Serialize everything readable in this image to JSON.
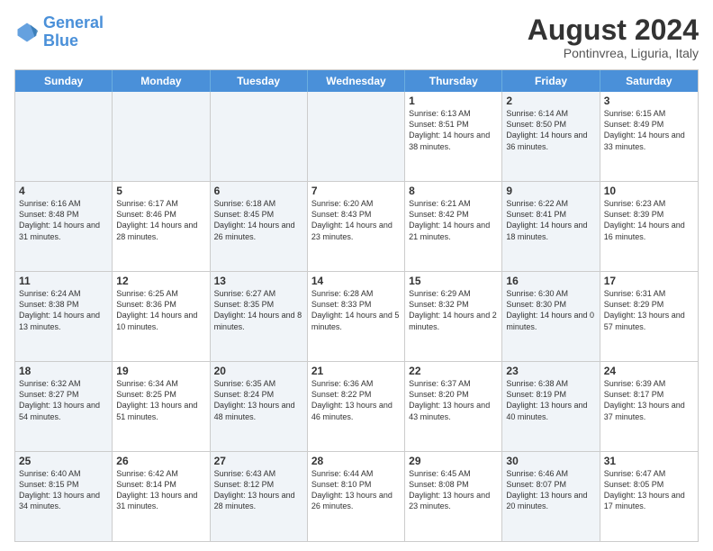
{
  "logo": {
    "line1": "General",
    "line2": "Blue"
  },
  "title": "August 2024",
  "location": "Pontinvrea, Liguria, Italy",
  "days_of_week": [
    "Sunday",
    "Monday",
    "Tuesday",
    "Wednesday",
    "Thursday",
    "Friday",
    "Saturday"
  ],
  "weeks": [
    [
      {
        "day": "",
        "text": "",
        "shaded": true
      },
      {
        "day": "",
        "text": "",
        "shaded": true
      },
      {
        "day": "",
        "text": "",
        "shaded": true
      },
      {
        "day": "",
        "text": "",
        "shaded": true
      },
      {
        "day": "1",
        "text": "Sunrise: 6:13 AM\nSunset: 8:51 PM\nDaylight: 14 hours\nand 38 minutes.",
        "shaded": false
      },
      {
        "day": "2",
        "text": "Sunrise: 6:14 AM\nSunset: 8:50 PM\nDaylight: 14 hours\nand 36 minutes.",
        "shaded": true
      },
      {
        "day": "3",
        "text": "Sunrise: 6:15 AM\nSunset: 8:49 PM\nDaylight: 14 hours\nand 33 minutes.",
        "shaded": false
      }
    ],
    [
      {
        "day": "4",
        "text": "Sunrise: 6:16 AM\nSunset: 8:48 PM\nDaylight: 14 hours\nand 31 minutes.",
        "shaded": true
      },
      {
        "day": "5",
        "text": "Sunrise: 6:17 AM\nSunset: 8:46 PM\nDaylight: 14 hours\nand 28 minutes.",
        "shaded": false
      },
      {
        "day": "6",
        "text": "Sunrise: 6:18 AM\nSunset: 8:45 PM\nDaylight: 14 hours\nand 26 minutes.",
        "shaded": true
      },
      {
        "day": "7",
        "text": "Sunrise: 6:20 AM\nSunset: 8:43 PM\nDaylight: 14 hours\nand 23 minutes.",
        "shaded": false
      },
      {
        "day": "8",
        "text": "Sunrise: 6:21 AM\nSunset: 8:42 PM\nDaylight: 14 hours\nand 21 minutes.",
        "shaded": false
      },
      {
        "day": "9",
        "text": "Sunrise: 6:22 AM\nSunset: 8:41 PM\nDaylight: 14 hours\nand 18 minutes.",
        "shaded": true
      },
      {
        "day": "10",
        "text": "Sunrise: 6:23 AM\nSunset: 8:39 PM\nDaylight: 14 hours\nand 16 minutes.",
        "shaded": false
      }
    ],
    [
      {
        "day": "11",
        "text": "Sunrise: 6:24 AM\nSunset: 8:38 PM\nDaylight: 14 hours\nand 13 minutes.",
        "shaded": true
      },
      {
        "day": "12",
        "text": "Sunrise: 6:25 AM\nSunset: 8:36 PM\nDaylight: 14 hours\nand 10 minutes.",
        "shaded": false
      },
      {
        "day": "13",
        "text": "Sunrise: 6:27 AM\nSunset: 8:35 PM\nDaylight: 14 hours\nand 8 minutes.",
        "shaded": true
      },
      {
        "day": "14",
        "text": "Sunrise: 6:28 AM\nSunset: 8:33 PM\nDaylight: 14 hours\nand 5 minutes.",
        "shaded": false
      },
      {
        "day": "15",
        "text": "Sunrise: 6:29 AM\nSunset: 8:32 PM\nDaylight: 14 hours\nand 2 minutes.",
        "shaded": false
      },
      {
        "day": "16",
        "text": "Sunrise: 6:30 AM\nSunset: 8:30 PM\nDaylight: 14 hours\nand 0 minutes.",
        "shaded": true
      },
      {
        "day": "17",
        "text": "Sunrise: 6:31 AM\nSunset: 8:29 PM\nDaylight: 13 hours\nand 57 minutes.",
        "shaded": false
      }
    ],
    [
      {
        "day": "18",
        "text": "Sunrise: 6:32 AM\nSunset: 8:27 PM\nDaylight: 13 hours\nand 54 minutes.",
        "shaded": true
      },
      {
        "day": "19",
        "text": "Sunrise: 6:34 AM\nSunset: 8:25 PM\nDaylight: 13 hours\nand 51 minutes.",
        "shaded": false
      },
      {
        "day": "20",
        "text": "Sunrise: 6:35 AM\nSunset: 8:24 PM\nDaylight: 13 hours\nand 48 minutes.",
        "shaded": true
      },
      {
        "day": "21",
        "text": "Sunrise: 6:36 AM\nSunset: 8:22 PM\nDaylight: 13 hours\nand 46 minutes.",
        "shaded": false
      },
      {
        "day": "22",
        "text": "Sunrise: 6:37 AM\nSunset: 8:20 PM\nDaylight: 13 hours\nand 43 minutes.",
        "shaded": false
      },
      {
        "day": "23",
        "text": "Sunrise: 6:38 AM\nSunset: 8:19 PM\nDaylight: 13 hours\nand 40 minutes.",
        "shaded": true
      },
      {
        "day": "24",
        "text": "Sunrise: 6:39 AM\nSunset: 8:17 PM\nDaylight: 13 hours\nand 37 minutes.",
        "shaded": false
      }
    ],
    [
      {
        "day": "25",
        "text": "Sunrise: 6:40 AM\nSunset: 8:15 PM\nDaylight: 13 hours\nand 34 minutes.",
        "shaded": true
      },
      {
        "day": "26",
        "text": "Sunrise: 6:42 AM\nSunset: 8:14 PM\nDaylight: 13 hours\nand 31 minutes.",
        "shaded": false
      },
      {
        "day": "27",
        "text": "Sunrise: 6:43 AM\nSunset: 8:12 PM\nDaylight: 13 hours\nand 28 minutes.",
        "shaded": true
      },
      {
        "day": "28",
        "text": "Sunrise: 6:44 AM\nSunset: 8:10 PM\nDaylight: 13 hours\nand 26 minutes.",
        "shaded": false
      },
      {
        "day": "29",
        "text": "Sunrise: 6:45 AM\nSunset: 8:08 PM\nDaylight: 13 hours\nand 23 minutes.",
        "shaded": false
      },
      {
        "day": "30",
        "text": "Sunrise: 6:46 AM\nSunset: 8:07 PM\nDaylight: 13 hours\nand 20 minutes.",
        "shaded": true
      },
      {
        "day": "31",
        "text": "Sunrise: 6:47 AM\nSunset: 8:05 PM\nDaylight: 13 hours\nand 17 minutes.",
        "shaded": false
      }
    ]
  ]
}
